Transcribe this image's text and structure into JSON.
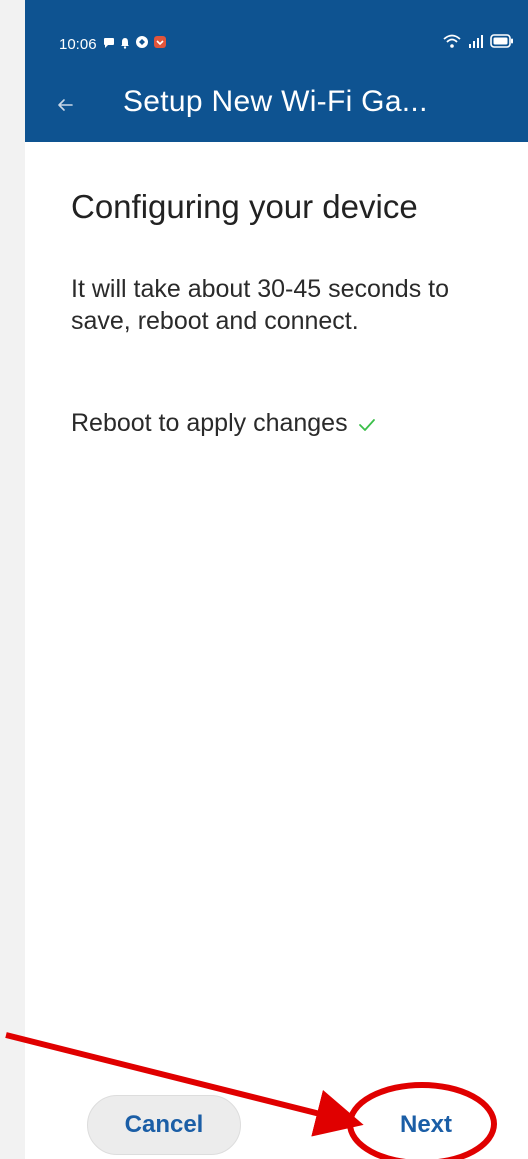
{
  "status_bar": {
    "time": "10:06",
    "left_icons": [
      "chat-bubble-icon",
      "notification-bell-icon",
      "app-icon",
      "shield-app-icon"
    ],
    "right_icons": [
      "wifi-icon",
      "signal-icon",
      "battery-icon"
    ]
  },
  "app_bar": {
    "title": "Setup New Wi-Fi Ga...",
    "back_icon": "arrow-left-icon"
  },
  "content": {
    "heading": "Configuring your device",
    "description": "It will take about 30-45 seconds to save, reboot and connect.",
    "status_line": "Reboot to apply changes",
    "status_icon": "check-icon"
  },
  "buttons": {
    "cancel_label": "Cancel",
    "next_label": "Next"
  },
  "colors": {
    "header": "#0e5391",
    "accent": "#1b5ea6",
    "check": "#3bbf4a",
    "annotation": "#e00000"
  }
}
